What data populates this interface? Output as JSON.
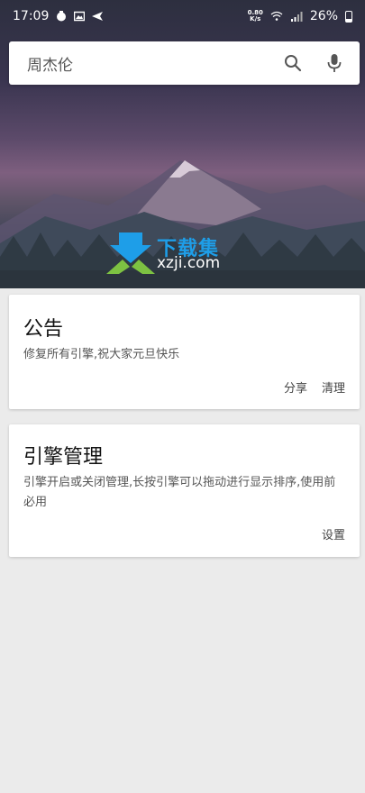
{
  "statusbar": {
    "time": "17:09",
    "netspeed_value": "0.80",
    "netspeed_unit": "K/s",
    "battery": "26%"
  },
  "search": {
    "query": "周杰伦",
    "search_icon": "search-icon",
    "mic_icon": "microphone-icon"
  },
  "watermark": {
    "title": "下载集",
    "site": "xzji.com"
  },
  "cards": [
    {
      "title": "公告",
      "desc": "修复所有引擎,祝大家元旦快乐",
      "actions": [
        "分享",
        "清理"
      ]
    },
    {
      "title": "引擎管理",
      "desc": "引擎开启或关闭管理,长按引擎可以拖动进行显示排序,使用前必用",
      "actions": [
        "设置"
      ]
    }
  ]
}
